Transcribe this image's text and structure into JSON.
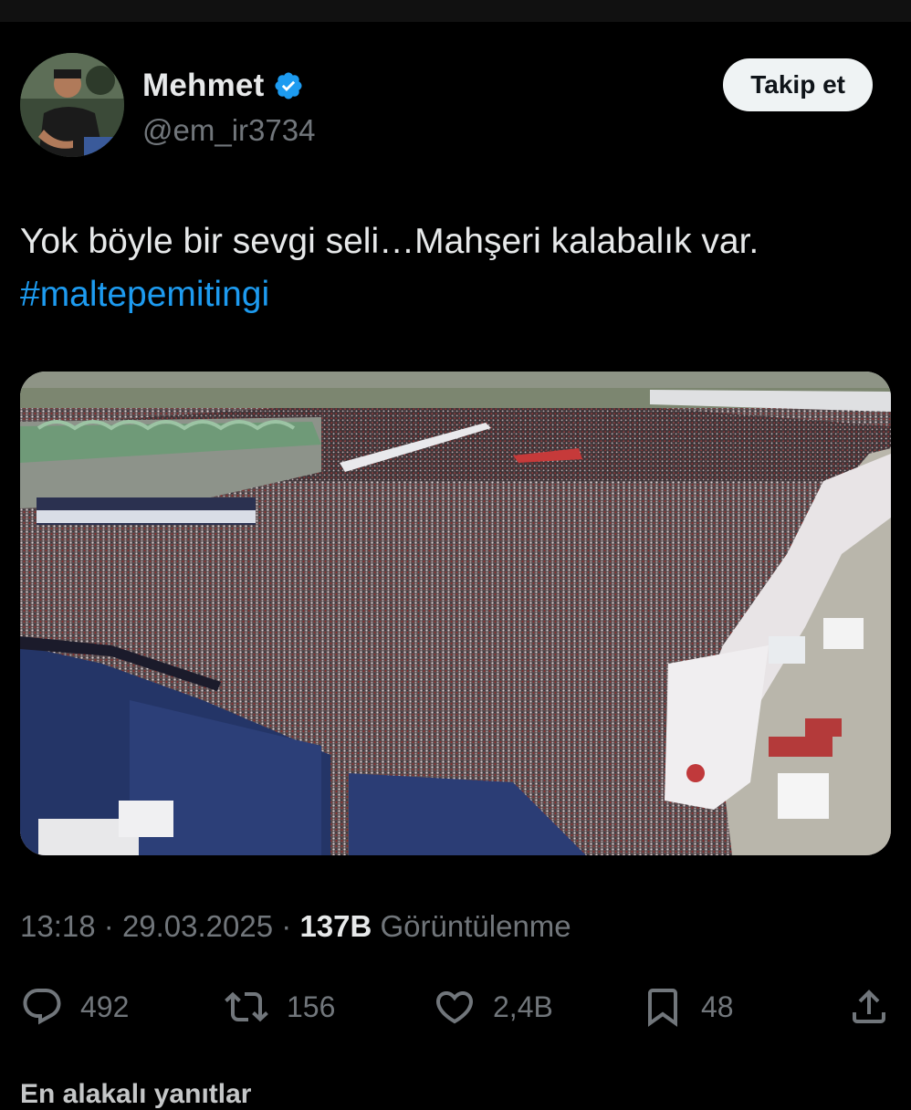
{
  "author": {
    "display_name": "Mehmet",
    "handle": "@em_ir3734",
    "verified": true,
    "verified_color": "#1d9bf0"
  },
  "follow_label": "Takip et",
  "tweet": {
    "text": "Yok böyle bir sevgi seli…Mahşeri kalabalık var.",
    "hashtag": "#maltepemitingi",
    "hashtag_color": "#1d9bf0"
  },
  "media_icon": "rally-crowd-photo",
  "meta": {
    "time": "13:18",
    "separator": "·",
    "date": "29.03.2025",
    "views_count": "137B",
    "views_label": "Görüntülenme"
  },
  "actions": {
    "reply": {
      "icon": "reply-icon",
      "count": "492"
    },
    "retweet": {
      "icon": "retweet-icon",
      "count": "156"
    },
    "like": {
      "icon": "heart-icon",
      "count": "2,4B"
    },
    "bookmark": {
      "icon": "bookmark-icon",
      "count": "48"
    },
    "share": {
      "icon": "share-icon"
    }
  },
  "replies_sort_label": "En alakalı yanıtlar"
}
